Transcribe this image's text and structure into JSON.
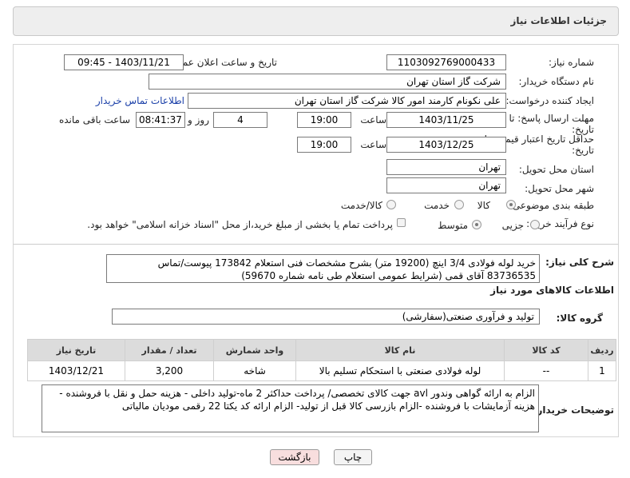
{
  "panel": {
    "title": "جزئیات اطلاعات نیاز"
  },
  "fields": {
    "need_number_label": "شماره نیاز:",
    "need_number": "1103092769000433",
    "announce_label": "تاریخ و ساعت اعلان عمومی:",
    "announce_value": "1403/11/21 - 09:45",
    "buyer_org_label": "نام دستگاه خریدار:",
    "buyer_org": "شرکت گاز استان تهران",
    "creator_label": "ایجاد کننده درخواست:",
    "creator": "علی نکونام کارمند امور کالا شرکت گاز استان تهران",
    "contact_link": "اطلاعات تماس خریدار",
    "deadline_label_1": "مهلت ارسال پاسخ: تا",
    "deadline_label_2": "تاریخ:",
    "deadline_date": "1403/11/25",
    "time_label": "ساعت",
    "deadline_time": "19:00",
    "days_value": "4",
    "days_label": "روز و",
    "remaining_time": "08:41:37",
    "remaining_label": "ساعت باقی مانده",
    "validity_label_1": "حداقل تاریخ اعتبار قیمت: تا",
    "validity_label_2": "تاریخ:",
    "validity_date": "1403/12/25",
    "validity_time": "19:00",
    "province_label": "استان محل تحویل:",
    "province": "تهران",
    "city_label": "شهر محل تحویل:",
    "city": "تهران",
    "category_label": "طبقه بندی موضوعی:",
    "category_options": [
      "کالا",
      "خدمت",
      "کالا/خدمت"
    ],
    "category_selected": "کالا",
    "process_label": "نوع فرآیند خرید :",
    "process_options": [
      "جزیی",
      "متوسط"
    ],
    "process_selected": "متوسط",
    "payment_note": "پرداخت تمام یا بخشی از مبلغ خرید،از محل \"اسناد خزانه اسلامی\" خواهد بود."
  },
  "description": {
    "label": "شرح کلی نیاز:",
    "text": "خرید لوله فولادی 3/4 اینچ (19200 متر) بشرح مشخصات فنی استعلام 173842 پیوست/تماس 83736535 آقای قمی (شرایط عمومی استعلام طی نامه شماره 59670)"
  },
  "goods_info_title": "اطلاعات کالاهای مورد نیاز",
  "goods_group": {
    "label": "گروه کالا:",
    "value": "تولید و فرآوری صنعتی(سفارشی)"
  },
  "table": {
    "headers": [
      "ردیف",
      "کد کالا",
      "نام کالا",
      "واحد شمارش",
      "تعداد / مقدار",
      "تاریخ نیاز"
    ],
    "rows": [
      [
        "1",
        "--",
        "لوله فولادی صنعتی با استحکام تسلیم بالا",
        "شاخه",
        "3,200",
        "1403/12/21"
      ]
    ]
  },
  "buyer_notes": {
    "label": "توضیحات خریدار:",
    "text": "الزام به ارائه گواهی وندور avl جهت کالای تخصصی/ پرداخت حداکثر 2 ماه-تولید داخلی - هزینه حمل و نقل با فروشنده - هزینه آزمایشات با فروشنده -الزام بازرسی کالا قبل از تولید- الزام ارائه کد یکتا 22 رقمی مودیان مالیاتی"
  },
  "buttons": {
    "print": "چاپ",
    "back": "بازگشت"
  },
  "colors": {
    "link": "#1a3fa8",
    "back_button_bg": "#f8dede",
    "header_bg": "#dcdcdc"
  }
}
